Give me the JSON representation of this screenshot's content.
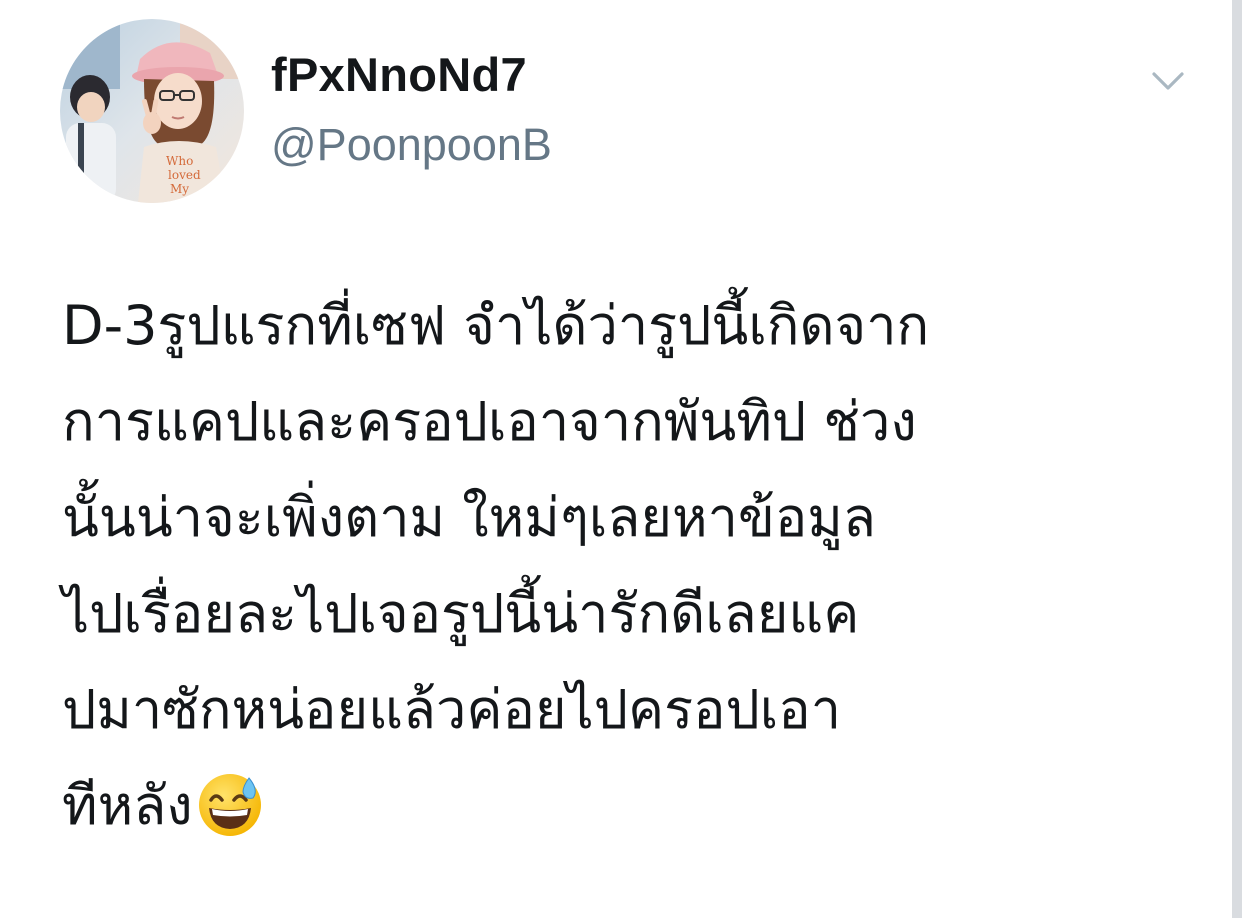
{
  "tweet": {
    "display_name": "fPxNnoNd7",
    "handle": "@PoonpoonB",
    "text_lines": [
      "D-3รูปแรกที่เซฟ จำได้ว่ารูปนี้เกิดจาก",
      "การแคปและครอปเอาจากพันทิป ช่วง",
      "นั้นน่าจะเพิ่งตาม ใหม่ๆเลยหาข้อมูล",
      "ไปเรื่อยละไปเจอรูปนี้น่ารักดีเลยแค",
      "ปมาซักหน่อยแล้วค่อยไปครอปเอา",
      "ทีหลัง"
    ],
    "emoji": "grinning-face-with-sweat",
    "avatar_shirt_text": "Who loved My"
  },
  "icons": {
    "menu": "chevron-down-icon"
  },
  "colors": {
    "name": "#14171a",
    "handle": "#657786",
    "caret": "#aab8c2",
    "edge": "#d9dce0"
  }
}
